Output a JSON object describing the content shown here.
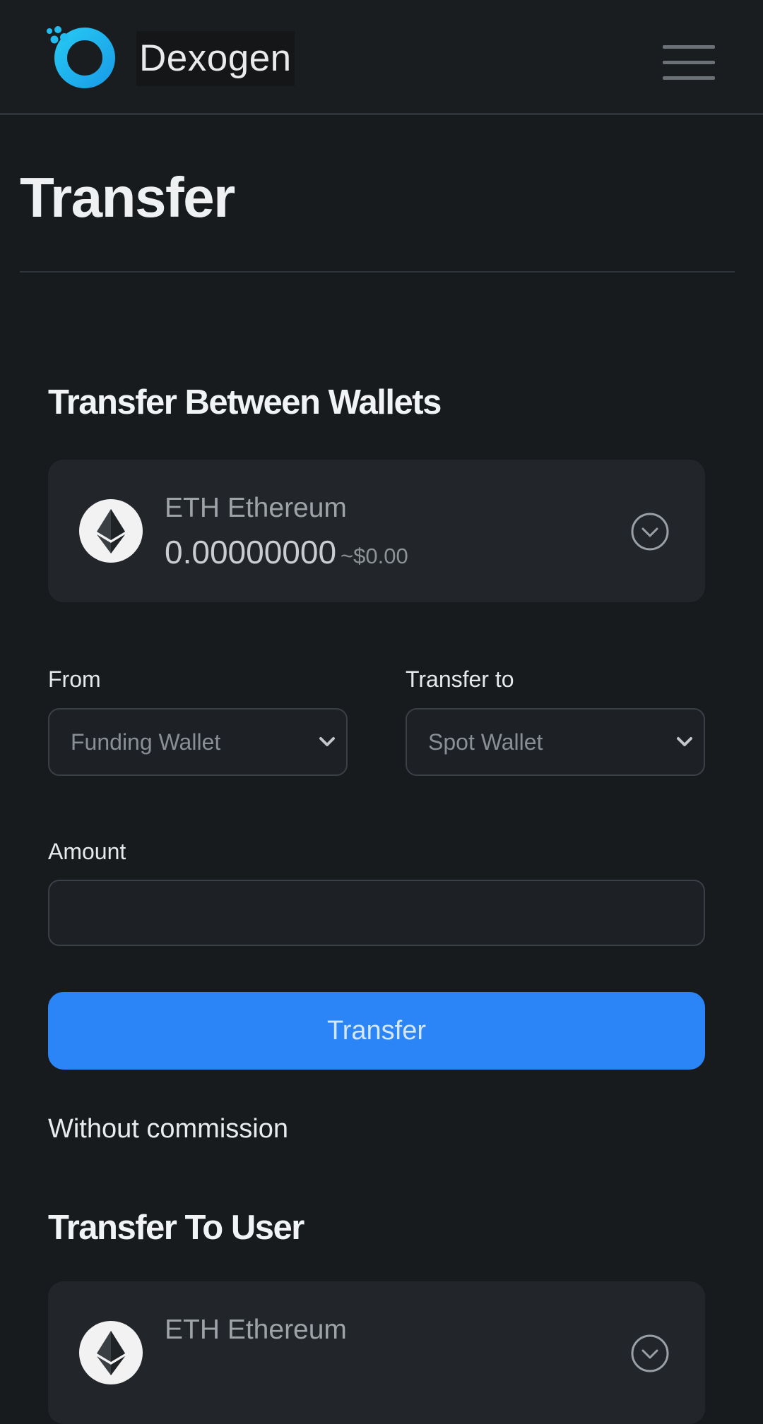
{
  "header": {
    "brand": "Dexogen",
    "logo_icon": "dexogen-logo-icon",
    "menu_icon": "hamburger-menu-icon"
  },
  "page": {
    "title": "Transfer"
  },
  "wallet_transfer": {
    "title": "Transfer Between Wallets",
    "coin": {
      "icon": "ethereum-icon",
      "name": "ETH Ethereum",
      "balance": "0.00000000",
      "usd": "~$0.00",
      "chevron_icon": "chevron-down-circle-icon"
    },
    "from": {
      "label": "From",
      "selected": "Funding Wallet"
    },
    "to": {
      "label": "Transfer to",
      "selected": "Spot Wallet"
    },
    "amount": {
      "label": "Amount",
      "value": "",
      "placeholder": ""
    },
    "submit_label": "Transfer",
    "note": "Without commission"
  },
  "user_transfer": {
    "title": "Transfer To User",
    "coin": {
      "icon": "ethereum-icon",
      "name": "ETH Ethereum",
      "chevron_icon": "chevron-down-circle-icon"
    }
  },
  "colors": {
    "background": "#181b1e",
    "card": "#22262a",
    "accent": "#2b85f7",
    "logo": "#1fb6ef"
  }
}
